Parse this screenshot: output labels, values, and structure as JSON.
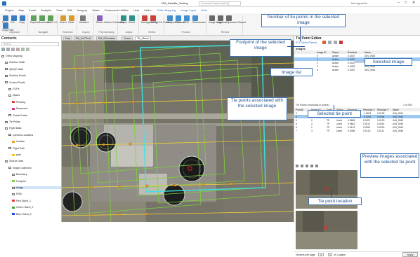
{
  "titlebar": {
    "project": "RM_Satellite_Testing",
    "search": "Command Search (Alt+Q)",
    "user": "Not signed in"
  },
  "menu": {
    "items": [
      "Project",
      "Map",
      "Insert",
      "Analysis",
      "View",
      "Edit",
      "Imagery",
      "Share",
      "Framework Utilities",
      "Help",
      "Add In",
      "Ortho Mapping",
      "Image Layer",
      "Data"
    ],
    "context": [
      "Ortho Mapping",
      "Image Layer",
      "Data"
    ]
  },
  "ribbon": {
    "groups": [
      {
        "label": "Clipboard",
        "buttons": [
          "Paste",
          "Cut",
          "Copy",
          "Copy Path"
        ]
      },
      {
        "label": "Navigate",
        "buttons": [
          "Explore",
          "Bookmarks",
          "Go To XY"
        ]
      },
      {
        "label": "Selection",
        "buttons": [
          "Select",
          "Clear"
        ]
      },
      {
        "label": "Inquiry",
        "buttons": [
          "Measure"
        ]
      },
      {
        "label": "Preprocessing",
        "buttons": [
          "Refine Interior Orientation"
        ]
      },
      {
        "label": "Adjust",
        "buttons": [
          "Adjust",
          "Reset"
        ]
      },
      {
        "label": "Refine",
        "buttons": [
          "Manage GCPs",
          "Manage Tie Points"
        ]
      },
      {
        "label": "Product",
        "buttons": [
          "Multiple Products",
          "DSM",
          "DTM",
          "Orthomosaic"
        ]
      },
      {
        "label": "Review",
        "buttons": [
          "Image Inspector",
          "Logs",
          "Adjustment Report"
        ]
      }
    ]
  },
  "contents": {
    "title": "Contents",
    "search_placeholder": "Search",
    "items": [
      {
        "label": "Ortho Mapping",
        "level": 0
      },
      {
        "label": "Solution Table",
        "level": 1
      },
      {
        "label": "QA/QC Data",
        "level": 1
      },
      {
        "label": "Solution Points",
        "level": 1
      },
      {
        "label": "Control Points",
        "level": 1
      },
      {
        "label": "GCPs",
        "level": 2
      },
      {
        "label": "Status",
        "level": 2
      },
      {
        "label": "Pending",
        "level": 3
      },
      {
        "label": "Measured",
        "level": 3
      },
      {
        "label": "Check Points",
        "level": 2
      },
      {
        "label": "Tie Points",
        "level": 1
      },
      {
        "label": "Flight Data",
        "level": 1
      },
      {
        "label": "Camera Locations",
        "level": 2
      },
      {
        "label": "location",
        "level": 3
      },
      {
        "label": "Flight Path",
        "level": 2
      },
      {
        "label": "path",
        "level": 3
      },
      {
        "label": "Source Data",
        "level": 1
      },
      {
        "label": "Image Collection",
        "level": 2
      },
      {
        "label": "Boundary",
        "level": 3
      },
      {
        "label": "Footprint",
        "level": 3
      },
      {
        "label": "Image",
        "level": 3
      },
      {
        "label": "RGB",
        "level": 3
      },
      {
        "label": "Red: Band_1",
        "level": 3
      },
      {
        "label": "Green: Band_2",
        "level": 3
      },
      {
        "label": "Blue: Band_3",
        "level": 3
      }
    ],
    "colors": {
      "pending": "#e03c31",
      "measured": "#d63384",
      "flight_path": "#f0c419",
      "camera": "#f0a020",
      "red": "#e53935",
      "green": "#43a047",
      "blue": "#1e40ff",
      "footprint": "#7dd13b"
    }
  },
  "map_tabs": [
    "Map",
    "RM_SaTTest1",
    "RM_SiSeeafian",
    "Scene",
    "Tie_Stereo"
  ],
  "tpe": {
    "title": "Tie Point Editor",
    "filter_label": "673 Points Filtered",
    "images_section": "Images",
    "image_columns": [
      "Image ID",
      "Status",
      "Residual",
      "Name"
    ],
    "image_rows": [
      [
        "0",
        "Active",
        "0.4437",
        "IUN_0040"
      ],
      [
        "1",
        "Active",
        "0.4457",
        "IUN_0041"
      ],
      [
        "2",
        "Active",
        "0.4437",
        "IUN_0042"
      ],
      [
        "3",
        "Active",
        "0.4432",
        "IUN_0043"
      ],
      [
        "4",
        "Active",
        "0.4337",
        "IUN_0044"
      ]
    ],
    "tiepoints_section": "Tie Points (residuals in pixels)",
    "tiepoints_count": "1 of 903",
    "tp_columns": [
      "PointID",
      "Image ID",
      "Type",
      "Status",
      "Residual",
      "Residual X",
      "Residual Y",
      "Name"
    ],
    "tp_rows": [
      [
        "2",
        "1",
        "TP",
        "Used",
        "0.2642",
        "-1.2601",
        "0.0125",
        "IUN_0041"
      ],
      [
        "3",
        "1",
        "TP",
        "Used",
        "0.0116",
        "-0.0251",
        "0.0254",
        "IUN_0042"
      ],
      [
        "4",
        "2",
        "TP",
        "Used",
        "0.0669",
        "0.0471",
        "0.0123",
        "IUN_0042"
      ],
      [
        "5",
        "2",
        "TP",
        "Used",
        "0.0642",
        "0.0117",
        "0.0014",
        "IUN_0043"
      ],
      [
        "6",
        "1",
        "TP",
        "Used",
        "0.0122",
        "0.0321",
        "0.0200",
        "IUN_0042"
      ],
      [
        "7",
        "3",
        "TP",
        "Used",
        "0.0456",
        "0.0123",
        "0.0111",
        "IUN_0044"
      ]
    ],
    "viewer_label": "Viewers per page",
    "viewer_count": "4",
    "page_label": "of 1 pages",
    "page_num": "1",
    "apply_label": "Apply"
  },
  "callouts": {
    "footprint": "Footprint of the selected image",
    "num_tie": "Number of tie points in the selected image",
    "image_list": "Image list",
    "selected_image": "Selected image",
    "tie_assoc": "Tie points associated with the selected image",
    "selected_tie": "Selected tie point",
    "preview": "Preview images associated with the selected tie point",
    "tie_location": "Tie point location"
  }
}
